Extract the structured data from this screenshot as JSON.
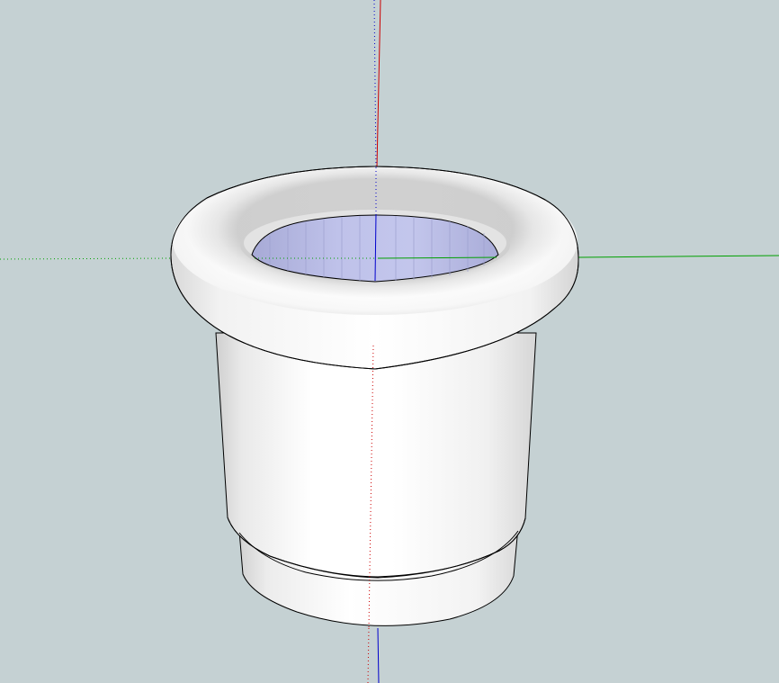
{
  "scene": {
    "background_color": "#c5d1d3",
    "model": "pot",
    "inner_face_color": "#b9bde6",
    "outer_face_color": "#ffffff",
    "edge_color": "#000000",
    "axes": {
      "red": "#cc0000",
      "green": "#00a000",
      "blue": "#0000cc"
    }
  }
}
